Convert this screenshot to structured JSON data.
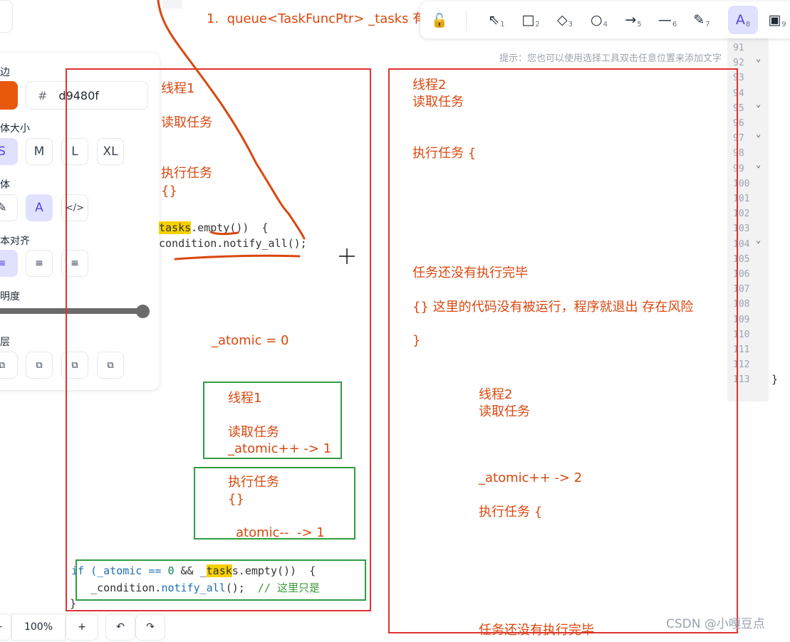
{
  "doc_line": "1.  queue<TaskFuncPtr> _tasks 有",
  "hint": "提示：您也可以使用选择工具双击任意位置来添加文字",
  "panel": {
    "stroke_label": "边",
    "hex_prefix": "#",
    "hex_value": "d9480f",
    "stroke_color": "#e8590c",
    "font_size_label": "体大小",
    "sizes": [
      "S",
      "M",
      "L",
      "XL"
    ],
    "font_label": "体",
    "font_icons": [
      "pencil-icon",
      "font-a-icon",
      "code-icon"
    ],
    "font_a_glyph": "A",
    "font_code_glyph": "</>",
    "align_label": "本对齐",
    "opacity_label": "明度",
    "opacity": 1.0,
    "layer_label": "层"
  },
  "toolbar": {
    "tools": [
      {
        "name": "lock-icon",
        "glyph": "🔓",
        "key": ""
      },
      {
        "name": "select-icon",
        "glyph": "⇖",
        "key": "1"
      },
      {
        "name": "rectangle-icon",
        "glyph": "□",
        "key": "2"
      },
      {
        "name": "diamond-icon",
        "glyph": "◇",
        "key": "3"
      },
      {
        "name": "ellipse-icon",
        "glyph": "○",
        "key": "4"
      },
      {
        "name": "arrow-icon",
        "glyph": "→",
        "key": "5"
      },
      {
        "name": "line-icon",
        "glyph": "—",
        "key": "6"
      },
      {
        "name": "pencil-icon",
        "glyph": "✎",
        "key": "7"
      },
      {
        "name": "text-icon",
        "glyph": "A",
        "key": "8"
      },
      {
        "name": "image-icon",
        "glyph": "▣",
        "key": "9"
      }
    ]
  },
  "box1": {
    "title": "线程1",
    "read": "读取任务",
    "exec": "执行任务",
    "braces": "{}",
    "code1_hl": "tasks",
    "code1_rest": ".empty())  {",
    "code2": "condition.notify_all();",
    "atomic": "_atomic = 0"
  },
  "green1": {
    "title": "线程1",
    "read": "读取任务",
    "inc": "_atomic++ -> 1"
  },
  "green2": {
    "exec": "执行任务",
    "braces": "{}",
    "dec": "atomic--  -> 1"
  },
  "green3": {
    "line1_a": "if (_atomic == ",
    "line1_num": "0",
    "line1_b": " && _",
    "line1_hl": "task",
    "line1_c": "s.empty())  {",
    "line2_a": "   _condition.",
    "line2_fn": "notify_all",
    "line2_b": "();  ",
    "line2_cmt": "// 这里只是",
    "brace": "}"
  },
  "box2": {
    "title": "线程2",
    "read": "读取任务",
    "exec": "执行任务 {",
    "not_done": "任务还没有执行完毕",
    "risk": "{} 这里的代码没有被运行，程序就退出 存在风险",
    "close": "}",
    "title2": "线程2",
    "read2": "读取任务",
    "inc": "_atomic++ -> 2",
    "exec2": "执行任务 {",
    "not_done2": "任务还没有执行完毕"
  },
  "gutter": {
    "lines": [
      "91",
      "92",
      "93",
      "94",
      "95",
      "96",
      "97",
      "98",
      "99",
      "100",
      "101",
      "102",
      "103",
      "104",
      "105",
      "106",
      "107",
      "108",
      "109",
      "110",
      "111",
      "112",
      "113"
    ],
    "fold_lines": [
      "92",
      "95",
      "97",
      "99",
      "104"
    ],
    "code_brace": "}"
  },
  "bottom": {
    "zoom": "100%",
    "minus": "−",
    "plus": "+",
    "undo": "↶",
    "redo": "↷"
  },
  "watermark": "CSDN @小嘎豆点",
  "colors": {
    "red_box": "#e03131",
    "green_box": "#2f9e44",
    "annotation": "#d9480f",
    "accent": "#4f46e5"
  }
}
